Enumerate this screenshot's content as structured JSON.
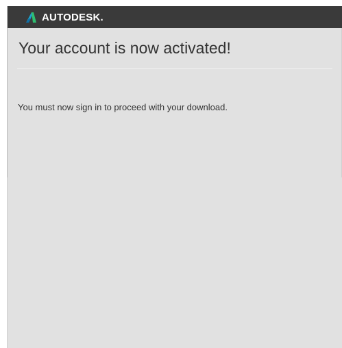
{
  "header": {
    "brand_name": "AUTODESK.",
    "logo_icon": "autodesk-logo-icon",
    "background": "#3a3a3a"
  },
  "main": {
    "title": "Your account is now activated!",
    "message": "You must now sign in to proceed with your download."
  }
}
